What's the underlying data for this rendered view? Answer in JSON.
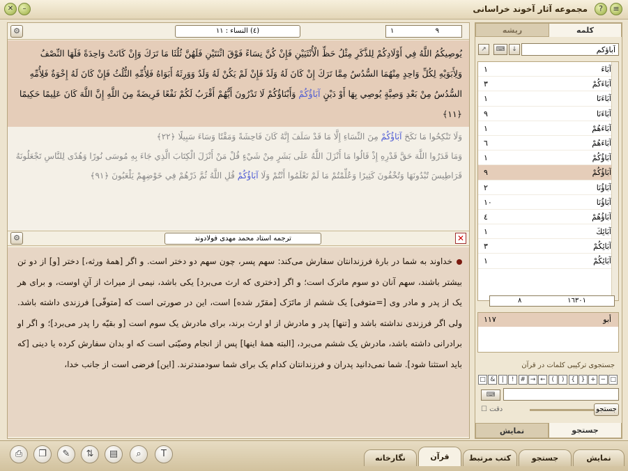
{
  "app": {
    "title": "مجموعه آثار آخوند خراسانی"
  },
  "verse_bar": {
    "sura_label": "(٤) النساء : ١١",
    "verse_from": "١",
    "verse_to": "٩"
  },
  "arabic": {
    "active_verse": "يُوصِيكُمُ اللَّهُ فِي أَوْلَادِكُمْ لِلذَّكَرِ مِثْلُ حَظِّ الْأُنْثَيَيْنِ فَإِنْ كُنَّ نِسَاءً فَوْقَ اثْنَتَيْنِ فَلَهُنَّ ثُلُثَا مَا تَرَكَ وَإِنْ كَانَتْ وَاحِدَةً فَلَهَا النِّصْفُ وَلِأَبَوَيْهِ لِكُلِّ وَاحِدٍ مِنْهُمَا السُّدُسُ مِمَّا تَرَكَ إِنْ كَانَ لَهُ وَلَدٌ فَإِنْ لَمْ يَكُنْ لَهُ وَلَدٌ وَوَرِثَهُ أَبَوَاهُ فَلِأُمِّهِ الثُّلُثُ فَإِنْ كَانَ لَهُ إِخْوَةٌ فَلِأُمِّهِ السُّدُسُ مِنْ بَعْدِ وَصِيَّةٍ يُوصِي بِهَا أَوْ دَيْنٍ",
    "active_highlight": "آبَاؤُكُمْ",
    "active_tail": "وَأَبْنَاؤُكُمْ لَا تَدْرُونَ أَيُّهُمْ أَقْرَبُ لَكُمْ نَفْعًا فَرِيضَةً مِنَ اللَّهِ إِنَّ اللَّهَ كَانَ عَلِيمًا حَكِيمًا ﴿١١﴾",
    "v22_pre": "وَلَا تَنْكِحُوا مَا نَكَحَ",
    "v22_hl": "آبَاؤُكُمْ",
    "v22_post": "مِنَ النِّسَاءِ إِلَّا مَا قَدْ سَلَفَ إِنَّهُ كَانَ فَاحِشَةً وَمَقْتًا وَسَاءَ سَبِيلًا ﴿٢٢﴾",
    "v91_pre": "وَمَا قَدَرُوا اللَّهَ حَقَّ قَدْرِهِ إِذْ قَالُوا مَا أَنْزَلَ اللَّهُ عَلَى بَشَرٍ مِنْ شَيْءٍ قُلْ مَنْ أَنْزَلَ الْكِتَابَ الَّذِي جَاءَ بِهِ مُوسَى نُورًا وَهُدًى لِلنَّاسِ تَجْعَلُونَهُ قَرَاطِيسَ تُبْدُونَهَا وَتُخْفُونَ كَثِيرًا وَعُلِّمْتُمْ مَا لَمْ تَعْلَمُوا أَنْتُمْ وَلَا",
    "v91_hl": "آبَاؤُكُمْ",
    "v91_post": "قُلِ اللَّهُ ثُمَّ ذَرْهُمْ فِي خَوْضِهِمْ يَلْعَبُونَ ﴿٩١﴾"
  },
  "translation": {
    "title": "ترجمه استاد محمد مهدی فولادوند",
    "text": "خداوند به شما در بارهٔ فرزندانتان سفارش می‌کند: سهم پسر، چون سهم دو دختر است. و اگر [همهٔ ورثه،] دختر [و] از دو تن بیشتر باشند، سهم آنان دو سوم ماترک است؛ و اگر [دختری که ارث می‌برد] یکی باشد، نیمی از میراث از آنِ اوست، و برای هر یک از پدر و مادر وی [=متوفی] یک ششم از ماتَرَک [مقرّر شده] است، این در صورتی است که [متوفّی] فرزندی داشته باشد. ولی اگر فرزندی نداشته باشد و [تنها] پدر و مادرش از او ارث برند، برای مادرش یک سوم است [و بقیّه را پدر می‌برد]؛ و اگر او برادرانی داشته باشد، مادرش یک ششم می‌برد، [البته همهٔ اینها] پس از انجام وصیّتی است که او بدان سفارش کرده یا دینی [که باید استثنا شود]. شما نمی‌دانید پدران و فرزندانتان کدام یک برای شما سودمندترند. [این] فرضی است از جانب خدا،"
  },
  "side": {
    "tab_word": "کلمه",
    "tab_root": "ریشه",
    "search_value": "آباؤکم",
    "words": [
      {
        "w": "آبَاءَ",
        "c": "١"
      },
      {
        "w": "آبَاءَكُمْ",
        "c": "٣"
      },
      {
        "w": "آبَاءَنَا",
        "c": "١"
      },
      {
        "w": "آبَاءَنَا",
        "c": "٩"
      },
      {
        "w": "آبَاءَهُمْ",
        "c": "١"
      },
      {
        "w": "آبَاءَهُمْ",
        "c": "٦"
      },
      {
        "w": "آبَاؤُكُمْ",
        "c": "١"
      },
      {
        "w": "آبَاؤُكُمْ",
        "c": "٩"
      },
      {
        "w": "آبَاؤُنَا",
        "c": "٢"
      },
      {
        "w": "آبَاؤُنَا",
        "c": "١٠"
      },
      {
        "w": "آبَاؤُهُمْ",
        "c": "٤"
      },
      {
        "w": "آبَائِكَ",
        "c": "١"
      },
      {
        "w": "آبَائِكُمْ",
        "c": "٣"
      },
      {
        "w": "آبَائِكُمْ",
        "c": "١"
      }
    ],
    "count_a": "٨",
    "count_b": "١٦٣٠١",
    "root_word": "أبو",
    "root_count": "١١٧",
    "combo_title": "جستجوی ترکیبی کلمات در قرآن",
    "ops": [
      "□",
      "&",
      "|",
      "!",
      "#",
      "→",
      "←",
      "(",
      ")",
      "{",
      "}",
      "+",
      "−",
      "□"
    ],
    "exact_label": "دقت",
    "go_label": "جستجو",
    "bottom_show": "نمایش",
    "bottom_search": "جستجو"
  },
  "bottom": {
    "tabs": [
      "نمایش",
      "جستجو",
      "کتب مرتبط",
      "قرآن",
      "نگارخانه"
    ],
    "tools": [
      "print",
      "copy",
      "note",
      "nav",
      "page",
      "search",
      "font"
    ]
  }
}
